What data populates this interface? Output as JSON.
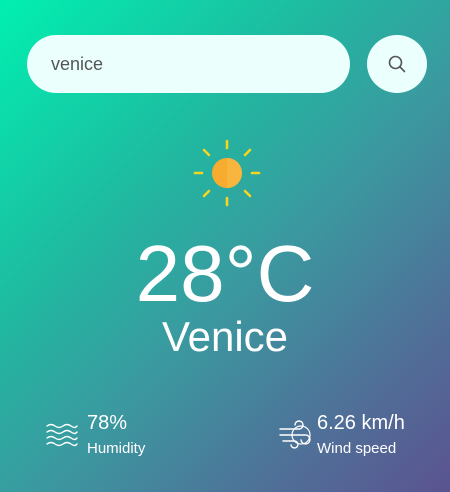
{
  "search": {
    "value": "venice",
    "placeholder": "",
    "button_icon": "search-icon"
  },
  "weather": {
    "icon": "sun-icon",
    "temperature": "28°C",
    "city": "Venice"
  },
  "details": {
    "humidity": {
      "icon": "humidity-waves-icon",
      "value": "78%",
      "label": "Humidity"
    },
    "wind": {
      "icon": "wind-icon",
      "value": "6.26 km/h",
      "label": "Wind speed"
    }
  },
  "colors": {
    "gradient_start": "#00f0b0",
    "gradient_end": "#5b5390",
    "input_background": "#ebfffc",
    "sun_core": "#f7ac2f",
    "sun_rays": "#f6d51f"
  }
}
